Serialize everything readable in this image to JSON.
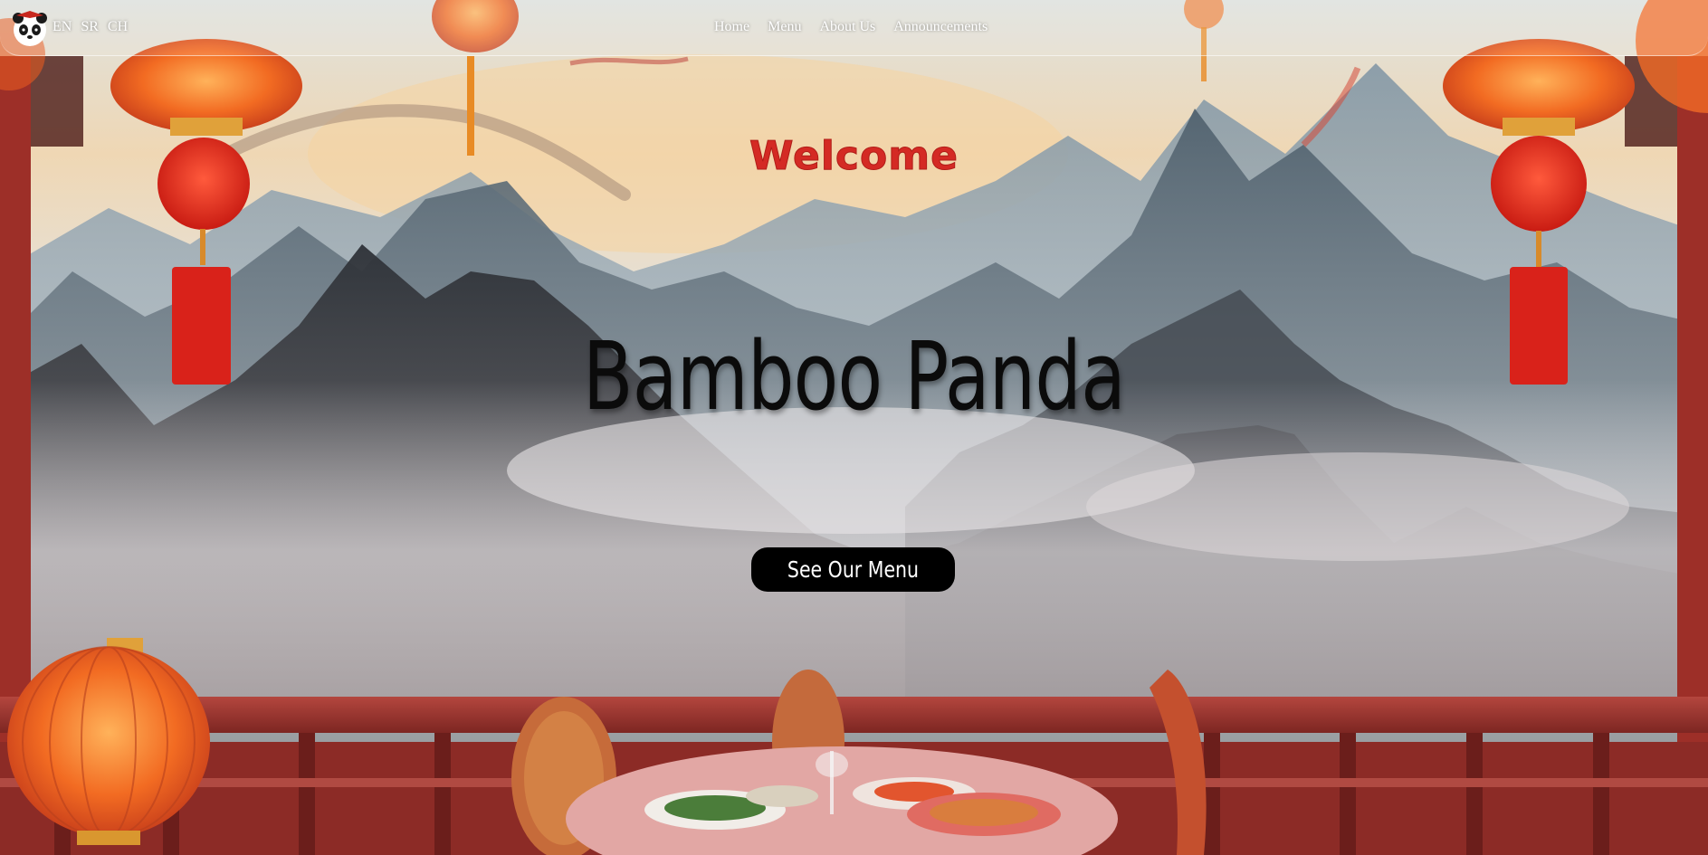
{
  "header": {
    "logo_alt": "Bamboo Panda logo",
    "languages": [
      "EN",
      "SR",
      "CH"
    ],
    "nav": [
      "Home",
      "Menu",
      "About Us",
      "Announcements"
    ]
  },
  "hero": {
    "welcome": "Welcome",
    "title": "Bamboo Panda",
    "cta_label": "See Our Menu"
  },
  "colors": {
    "accent_red": "#d42a24",
    "button_bg": "#000000",
    "button_text": "#ffffff"
  },
  "icons": {
    "logo": "panda-logo-icon"
  }
}
